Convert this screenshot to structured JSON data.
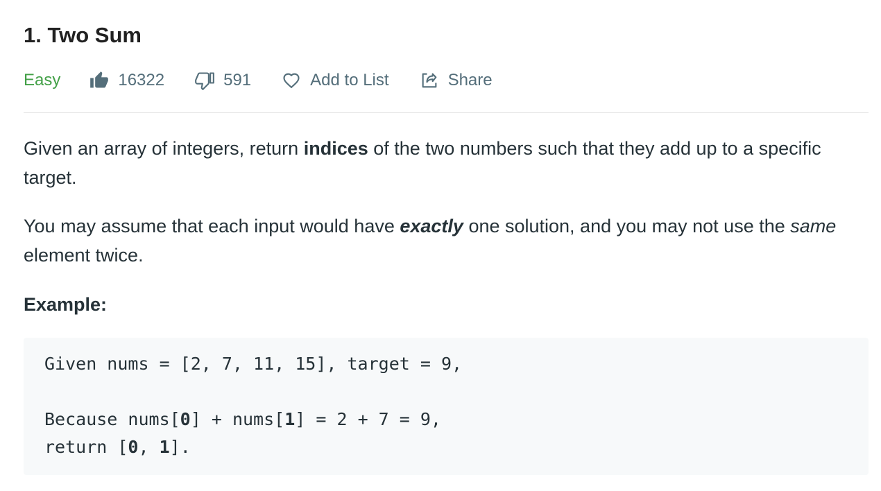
{
  "problem": {
    "title": "1. Two Sum",
    "difficulty": "Easy",
    "likes": "16322",
    "dislikes": "591",
    "add_to_list_label": "Add to List",
    "share_label": "Share"
  },
  "description": {
    "p1_a": "Given an array of integers, return ",
    "p1_b": "indices",
    "p1_c": " of the two numbers such that they add up to a specific target.",
    "p2_a": "You may assume that each input would have ",
    "p2_b": "exactly",
    "p2_c": " one solution, and you may not use the ",
    "p2_d": "same",
    "p2_e": " element twice."
  },
  "example": {
    "heading": "Example:",
    "line1": "Given nums = [2, 7, 11, 15], target = 9,",
    "line3_a": "Because nums[",
    "line3_b": "0",
    "line3_c": "] + nums[",
    "line3_d": "1",
    "line3_e": "] = 2 + 7 = 9,",
    "line4_a": "return [",
    "line4_b": "0",
    "line4_c": ", ",
    "line4_d": "1",
    "line4_e": "]."
  },
  "colors": {
    "difficulty_easy": "#43a047",
    "meta_text": "#546e7a",
    "code_bg": "#f7f9fa"
  },
  "icons": {
    "like": "thumbs-up-icon",
    "dislike": "thumbs-down-icon",
    "add_to_list": "heart-icon",
    "share": "share-icon"
  }
}
